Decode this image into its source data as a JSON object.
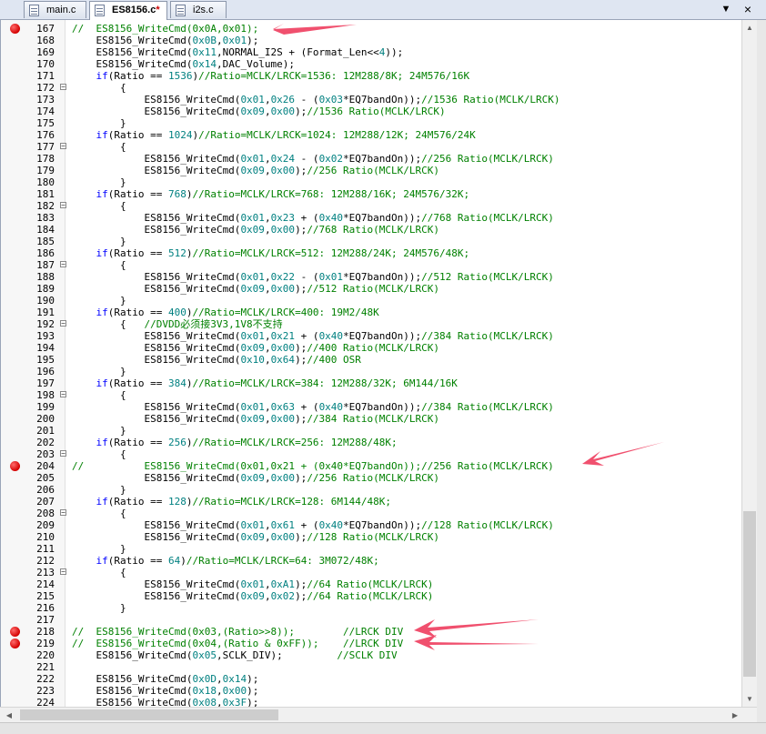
{
  "tabs": [
    {
      "label": "main.c",
      "modified": ""
    },
    {
      "label": "ES8156.c",
      "modified": "*"
    },
    {
      "label": "i2s.c",
      "modified": ""
    }
  ],
  "tab_controls": {
    "dropdown": "▼",
    "close": "×"
  },
  "scroll_glyphs": {
    "up": "▲",
    "down": "▼",
    "left": "◀",
    "right": "▶"
  },
  "accent": {
    "breakpoint": "#d40000",
    "arrow": "#f0506e"
  },
  "lines": [
    {
      "n": "167",
      "bp": true,
      "t": "//  ES8156_WriteCmd(0x0A,0x01);"
    },
    {
      "n": "168",
      "t": "    ES8156_WriteCmd(0x0B,0x01);"
    },
    {
      "n": "169",
      "t": "    ES8156_WriteCmd(0x11,NORMAL_I2S + (Format_Len<<4));"
    },
    {
      "n": "170",
      "t": "    ES8156_WriteCmd(0x14,DAC_Volume);"
    },
    {
      "n": "171",
      "t": "    if(Ratio == 1536)//Ratio=MCLK/LRCK=1536: 12M288/8K; 24M576/16K"
    },
    {
      "n": "172",
      "fold": true,
      "t": "        {"
    },
    {
      "n": "173",
      "t": "            ES8156_WriteCmd(0x01,0x26 - (0x03*EQ7bandOn));//1536 Ratio(MCLK/LRCK)"
    },
    {
      "n": "174",
      "t": "            ES8156_WriteCmd(0x09,0x00);//1536 Ratio(MCLK/LRCK)"
    },
    {
      "n": "175",
      "t": "        }"
    },
    {
      "n": "176",
      "t": "    if(Ratio == 1024)//Ratio=MCLK/LRCK=1024: 12M288/12K; 24M576/24K"
    },
    {
      "n": "177",
      "fold": true,
      "t": "        {"
    },
    {
      "n": "178",
      "t": "            ES8156_WriteCmd(0x01,0x24 - (0x02*EQ7bandOn));//256 Ratio(MCLK/LRCK)"
    },
    {
      "n": "179",
      "t": "            ES8156_WriteCmd(0x09,0x00);//256 Ratio(MCLK/LRCK)"
    },
    {
      "n": "180",
      "t": "        }"
    },
    {
      "n": "181",
      "t": "    if(Ratio == 768)//Ratio=MCLK/LRCK=768: 12M288/16K; 24M576/32K;"
    },
    {
      "n": "182",
      "fold": true,
      "t": "        {"
    },
    {
      "n": "183",
      "t": "            ES8156_WriteCmd(0x01,0x23 + (0x40*EQ7bandOn));//768 Ratio(MCLK/LRCK)"
    },
    {
      "n": "184",
      "t": "            ES8156_WriteCmd(0x09,0x00);//768 Ratio(MCLK/LRCK)"
    },
    {
      "n": "185",
      "t": "        }"
    },
    {
      "n": "186",
      "t": "    if(Ratio == 512)//Ratio=MCLK/LRCK=512: 12M288/24K; 24M576/48K;"
    },
    {
      "n": "187",
      "fold": true,
      "t": "        {"
    },
    {
      "n": "188",
      "t": "            ES8156_WriteCmd(0x01,0x22 - (0x01*EQ7bandOn));//512 Ratio(MCLK/LRCK)"
    },
    {
      "n": "189",
      "t": "            ES8156_WriteCmd(0x09,0x00);//512 Ratio(MCLK/LRCK)"
    },
    {
      "n": "190",
      "t": "        }"
    },
    {
      "n": "191",
      "t": "    if(Ratio == 400)//Ratio=MCLK/LRCK=400: 19M2/48K"
    },
    {
      "n": "192",
      "fold": true,
      "t": "        {   //DVDD必须接3V3,1V8不支持"
    },
    {
      "n": "193",
      "t": "            ES8156_WriteCmd(0x01,0x21 + (0x40*EQ7bandOn));//384 Ratio(MCLK/LRCK)"
    },
    {
      "n": "194",
      "t": "            ES8156_WriteCmd(0x09,0x00);//400 Ratio(MCLK/LRCK)"
    },
    {
      "n": "195",
      "t": "            ES8156_WriteCmd(0x10,0x64);//400 OSR"
    },
    {
      "n": "196",
      "t": "        }"
    },
    {
      "n": "197",
      "t": "    if(Ratio == 384)//Ratio=MCLK/LRCK=384: 12M288/32K; 6M144/16K"
    },
    {
      "n": "198",
      "fold": true,
      "t": "        {"
    },
    {
      "n": "199",
      "t": "            ES8156_WriteCmd(0x01,0x63 + (0x40*EQ7bandOn));//384 Ratio(MCLK/LRCK)"
    },
    {
      "n": "200",
      "t": "            ES8156_WriteCmd(0x09,0x00);//384 Ratio(MCLK/LRCK)"
    },
    {
      "n": "201",
      "t": "        }"
    },
    {
      "n": "202",
      "t": "    if(Ratio == 256)//Ratio=MCLK/LRCK=256: 12M288/48K;"
    },
    {
      "n": "203",
      "fold": true,
      "t": "        {"
    },
    {
      "n": "204",
      "bp": true,
      "t": "//          ES8156_WriteCmd(0x01,0x21 + (0x40*EQ7bandOn));//256 Ratio(MCLK/LRCK)"
    },
    {
      "n": "205",
      "t": "            ES8156_WriteCmd(0x09,0x00);//256 Ratio(MCLK/LRCK)"
    },
    {
      "n": "206",
      "t": "        }"
    },
    {
      "n": "207",
      "t": "    if(Ratio == 128)//Ratio=MCLK/LRCK=128: 6M144/48K;"
    },
    {
      "n": "208",
      "fold": true,
      "t": "        {"
    },
    {
      "n": "209",
      "t": "            ES8156_WriteCmd(0x01,0x61 + (0x40*EQ7bandOn));//128 Ratio(MCLK/LRCK)"
    },
    {
      "n": "210",
      "t": "            ES8156_WriteCmd(0x09,0x00);//128 Ratio(MCLK/LRCK)"
    },
    {
      "n": "211",
      "t": "        }"
    },
    {
      "n": "212",
      "t": "    if(Ratio == 64)//Ratio=MCLK/LRCK=64: 3M072/48K;"
    },
    {
      "n": "213",
      "fold": true,
      "t": "        {"
    },
    {
      "n": "214",
      "t": "            ES8156_WriteCmd(0x01,0xA1);//64 Ratio(MCLK/LRCK)"
    },
    {
      "n": "215",
      "t": "            ES8156_WriteCmd(0x09,0x02);//64 Ratio(MCLK/LRCK)"
    },
    {
      "n": "216",
      "t": "        }"
    },
    {
      "n": "217",
      "t": ""
    },
    {
      "n": "218",
      "bp": true,
      "t": "//  ES8156_WriteCmd(0x03,(Ratio>>8));        //LRCK DIV"
    },
    {
      "n": "219",
      "bp": true,
      "t": "//  ES8156_WriteCmd(0x04,(Ratio & 0xFF));    //LRCK DIV"
    },
    {
      "n": "220",
      "t": "    ES8156_WriteCmd(0x05,SCLK_DIV);         //SCLK DIV"
    },
    {
      "n": "221",
      "t": ""
    },
    {
      "n": "222",
      "t": "    ES8156_WriteCmd(0x0D,0x14);"
    },
    {
      "n": "223",
      "t": "    ES8156_WriteCmd(0x18,0x00);"
    },
    {
      "n": "224",
      "t": "    ES8156_WriteCmd(0x08,0x3F);"
    }
  ]
}
